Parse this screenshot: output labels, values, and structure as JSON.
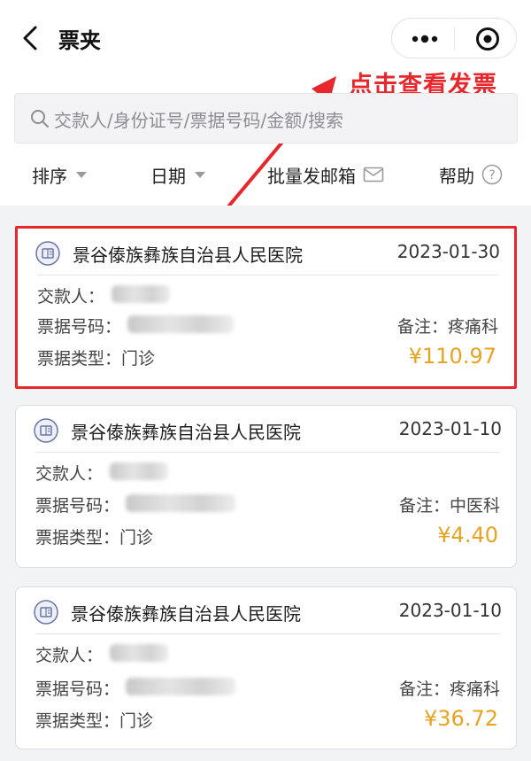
{
  "header": {
    "title": "票夹",
    "back_icon": "chevron-left-icon",
    "more_icon": "more-dots-icon",
    "target_icon": "target-circle-icon"
  },
  "annotation": {
    "text": "点击查看发票",
    "color": "#e8272d"
  },
  "search": {
    "placeholder": "交款人/身份证号/票据号码/金额/搜索"
  },
  "filters": {
    "sort_label": "排序",
    "date_label": "日期",
    "batch_email_label": "批量发邮箱",
    "help_label": "帮助"
  },
  "labels": {
    "payer": "交款人：",
    "invoice_no": "票据号码：",
    "invoice_type": "票据类型：",
    "remark": "备注："
  },
  "invoices": [
    {
      "hospital": "景谷傣族彝族自治县人民医院",
      "date": "2023-01-30",
      "remark": "疼痛科",
      "type": "门诊",
      "amount": "¥110.97",
      "highlighted": true
    },
    {
      "hospital": "景谷傣族彝族自治县人民医院",
      "date": "2023-01-10",
      "remark": "中医科",
      "type": "门诊",
      "amount": "¥4.40",
      "highlighted": false
    },
    {
      "hospital": "景谷傣族彝族自治县人民医院",
      "date": "2023-01-10",
      "remark": "疼痛科",
      "type": "门诊",
      "amount": "¥36.72",
      "highlighted": false
    }
  ],
  "colors": {
    "accent_red": "#e8272d",
    "amount_gold": "#e8a321",
    "list_bg": "#f2f3f5"
  }
}
